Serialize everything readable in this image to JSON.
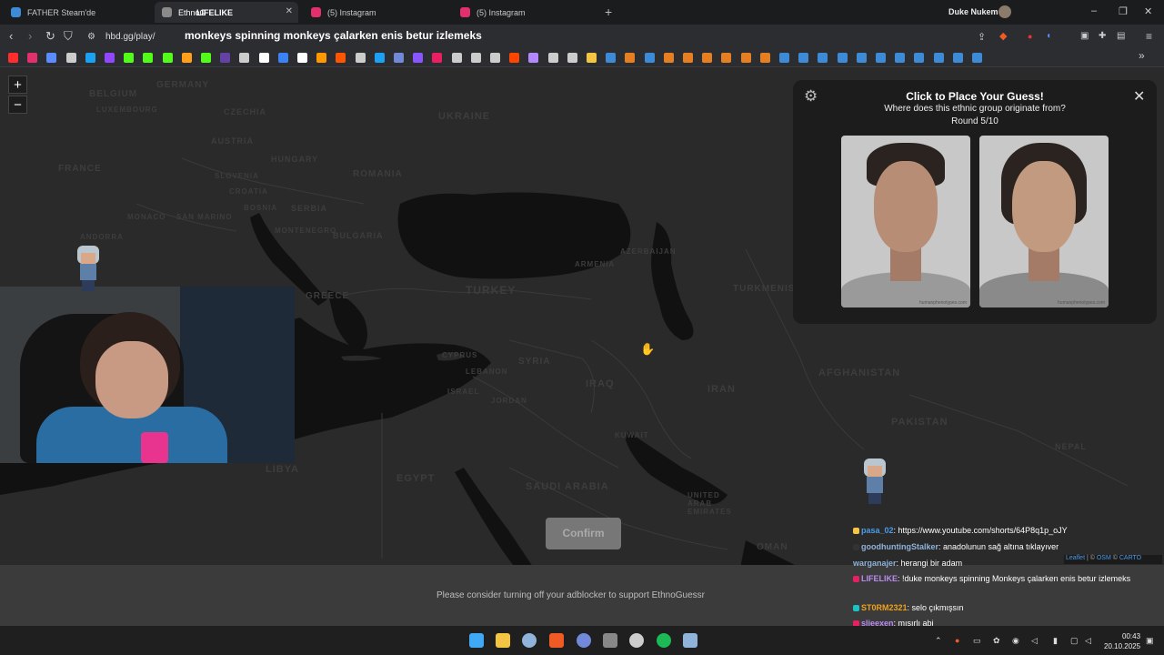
{
  "browser": {
    "tabs": [
      {
        "label": "FATHER Steam'de",
        "color": "#3d8bd6"
      },
      {
        "label": "EthnoG",
        "overlay": "LIFELIKE",
        "color": "#8a8a8a"
      },
      {
        "label": "(5) Instagram",
        "color": "#e1306c"
      },
      {
        "label": "(5) Instagram",
        "color": "#e1306c"
      }
    ],
    "new_tab": "+",
    "profile_name": "Duke Nukem",
    "window_controls": [
      "–",
      "❐",
      "✕"
    ],
    "url": "hbd.gg/play/",
    "omnibox_suggestion": "monkeys spinning monkeys çalarken enis betur izlemeks",
    "bookmarks_overflow": "»",
    "bookmark_colors": [
      "#ff2d2d",
      "#e1306c",
      "#5b8cff",
      "#cccccc",
      "#1aa1f2",
      "#9146ff",
      "#53fc18",
      "#53fc18",
      "#53fc18",
      "#ff9f1a",
      "#53fc18",
      "#6441a5",
      "#cccccc",
      "#ffffff",
      "#3b82f6",
      "#ffffff",
      "#ff9900",
      "#ff5500",
      "#cccccc",
      "#1da1f2",
      "#7289da",
      "#8855ff",
      "#e91e63",
      "#cccccc",
      "#cccccc",
      "#cccccc",
      "#ff4500",
      "#b388ff",
      "#cccccc",
      "#cccccc",
      "#f4c542",
      "#3d8bd6",
      "#e67e22",
      "#3d8bd6",
      "#e67e22",
      "#e67e22",
      "#e67e22",
      "#e67e22",
      "#e67e22",
      "#e67e22",
      "#3d8bd6",
      "#3d8bd6",
      "#3d8bd6",
      "#3d8bd6",
      "#3d8bd6",
      "#3d8bd6",
      "#3d8bd6",
      "#3d8bd6",
      "#3d8bd6",
      "#3d8bd6",
      "#3d8bd6"
    ]
  },
  "map": {
    "zoom_in": "+",
    "zoom_out": "−",
    "labels": [
      "BELGIUM",
      "LUXEMBOURG",
      "GERMANY",
      "CZECHIA",
      "UKRAINE",
      "FRANCE",
      "AUSTRIA",
      "HUNGARY",
      "SLOVENIA",
      "CROATIA",
      "BOSNIA",
      "SERBIA",
      "MONACO",
      "SAN MARINO",
      "MONTENEGRO",
      "ROMANIA",
      "BULGARIA",
      "ANDORRA",
      "GREECE",
      "TURKEY",
      "ARMENIA",
      "AZERBAIJAN",
      "TURKMENISTAN",
      "CYPRUS",
      "LEBANON",
      "SYRIA",
      "ISRAEL",
      "JORDAN",
      "IRAQ",
      "IRAN",
      "AFGHANISTAN",
      "PAKISTAN",
      "KUWAIT",
      "SAUDI ARABIA",
      "UNITED ARAB EMIRATES",
      "OMAN",
      "NEPAL",
      "LIBYA",
      "EGYPT"
    ],
    "attribution": {
      "leaflet": "Leaflet",
      "osm": "OSM",
      "carto": "CARTO"
    }
  },
  "game": {
    "title": "Click to Place Your Guess!",
    "question": "Where does this ethnic group originate from?",
    "round": "Round 5/10",
    "photo_credit": "humanphenotypes.com",
    "confirm_label": "Confirm",
    "close": "✕",
    "settings_icon": "⚙"
  },
  "adblock_message": "Please consider turning off your adblocker to support EthnoGuessr",
  "chat": [
    {
      "user": "pasa_02",
      "text": ": https://www.youtube.com/shorts/64P8q1p_oJY",
      "color": "#4d9be6",
      "badge": "#f4c542"
    },
    {
      "user": "goodhuntingStalker",
      "text": ": anadolunun sağ altına tıklayıver",
      "color": "#8fb3d9",
      "badge": "#333"
    },
    {
      "user": "warganajer",
      "text": ": herangi bir adam",
      "color": "#8fb3d9",
      "badge": ""
    },
    {
      "user": "LIFELIKE",
      "text": ": !duke monkeys spinning Monkeys çalarken enis betur izlemeks",
      "color": "#b98cf0",
      "badge": "#e91e63"
    },
    {
      "user": "ST0RM2321",
      "text": ": selo çıkmışsın",
      "color": "#f0a21c",
      "badge": "#19c3c3"
    },
    {
      "user": "slieexen",
      "text": ": mısırlı abi",
      "color": "#b98cf0",
      "badge": "#e91e63"
    }
  ],
  "taskbar": {
    "apps": [
      {
        "name": "windows",
        "color": "#3fa9f5"
      },
      {
        "name": "file-explorer",
        "color": "#f4c542"
      },
      {
        "name": "steam",
        "color": "#8fb3d9"
      },
      {
        "name": "brave",
        "color": "#f05a24"
      },
      {
        "name": "discord",
        "color": "#7289da"
      },
      {
        "name": "app",
        "color": "#888888"
      },
      {
        "name": "obs",
        "color": "#cccccc"
      },
      {
        "name": "spotify",
        "color": "#1db954"
      },
      {
        "name": "app2",
        "color": "#8fb3d9"
      }
    ],
    "time": "00:43",
    "date": "20.10.2025"
  }
}
